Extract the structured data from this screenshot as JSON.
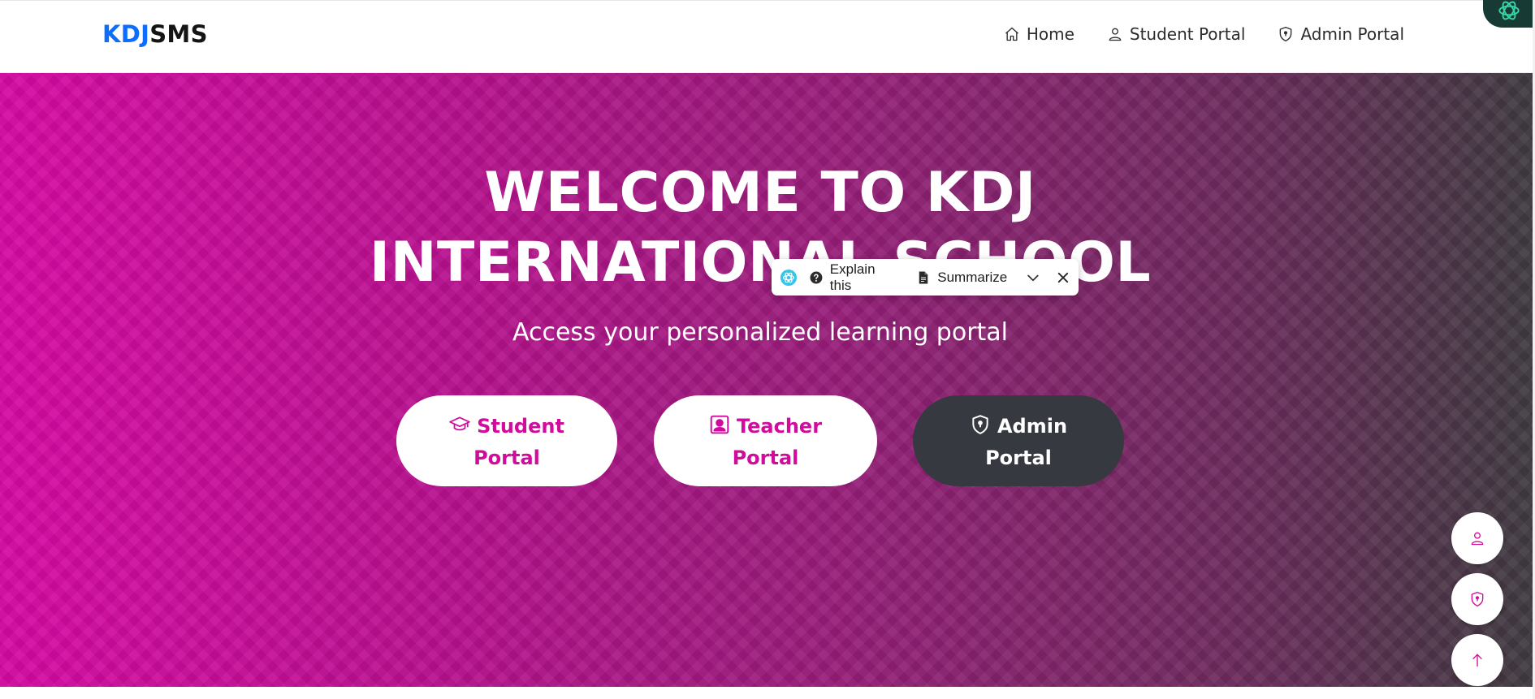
{
  "brand": {
    "part1": "KDJ",
    "part2": "SMS"
  },
  "nav": {
    "links": [
      {
        "label": "Home",
        "icon": "home-icon"
      },
      {
        "label": "Student Portal",
        "icon": "person-icon"
      },
      {
        "label": "Admin Portal",
        "icon": "shield-icon"
      }
    ]
  },
  "hero": {
    "title_line1": "WELCOME TO KDJ",
    "title_line2": "INTERNATIONAL SCHOOL",
    "subtitle": "Access your personalized learning portal",
    "buttons": [
      {
        "line1": "Student",
        "line2": "Portal",
        "icon": "graduation-cap-icon"
      },
      {
        "line1": "Teacher",
        "line2": "Portal",
        "icon": "teacher-badge-icon"
      },
      {
        "line1": "Admin",
        "line2": "Portal",
        "icon": "shield-icon"
      }
    ]
  },
  "popup": {
    "explain_label": "Explain this",
    "summarize_label": "Summarize"
  },
  "fab": {
    "icons": [
      "person-icon",
      "shield-icon",
      "arrow-up-icon"
    ]
  },
  "colors": {
    "brand_blue": "#0d6efd",
    "accent_magenta": "#d10b9c",
    "admin_dark": "#363a40",
    "gradient_start": "#d609a3",
    "gradient_end": "#3f3a40"
  }
}
